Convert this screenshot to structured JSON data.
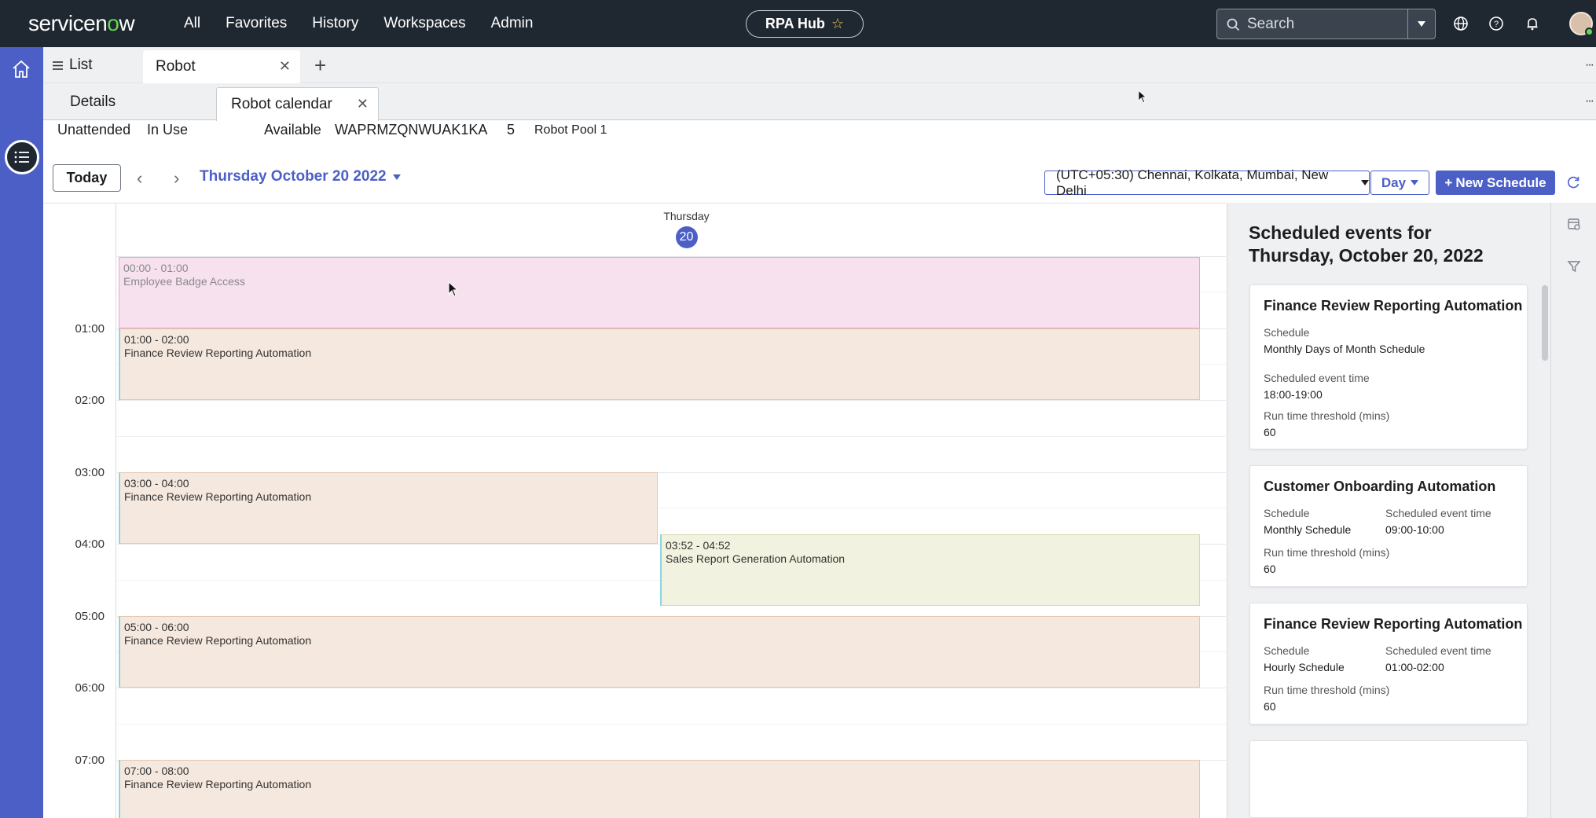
{
  "topnav": {
    "logo_left": "servicen",
    "logo_o": "o",
    "logo_right": "w",
    "menu": [
      "All",
      "Favorites",
      "History",
      "Workspaces",
      "Admin"
    ],
    "center_title": "RPA Hub",
    "search_placeholder": "Search"
  },
  "tabs1": {
    "list_label": "List",
    "robot_label": "Robot"
  },
  "tabs2": {
    "details_label": "Details",
    "calendar_label": "Robot calendar"
  },
  "info": {
    "type": "Unattended",
    "status": "In Use",
    "availability": "Available",
    "id": "WAPRMZQNWUAK1KA",
    "count": "5",
    "pool": "Robot Pool 1"
  },
  "toolbar": {
    "today_label": "Today",
    "date_label": "Thursday October 20 2022",
    "timezone": "(UTC+05:30) Chennai, Kolkata, Mumbai, New Delhi",
    "view": "Day",
    "new_schedule": "New Schedule"
  },
  "calendar": {
    "day_name": "Thursday",
    "day_number": "20",
    "hours": [
      "01:00",
      "02:00",
      "03:00",
      "04:00",
      "05:00",
      "06:00",
      "07:00"
    ],
    "events": [
      {
        "time": "00:00 - 01:00",
        "title": "Employee Badge Access",
        "color": "#f7e1ef"
      },
      {
        "time": "01:00 - 02:00",
        "title": "Finance Review Reporting Automation",
        "color": "#f5e8de"
      },
      {
        "time": "03:00 - 04:00",
        "title": "Finance Review Reporting Automation",
        "color": "#f5e8de"
      },
      {
        "time": "03:52 - 04:52",
        "title": "Sales Report Generation Automation",
        "color": "#f1f2df"
      },
      {
        "time": "05:00 - 06:00",
        "title": "Finance Review Reporting Automation",
        "color": "#f5e8de"
      },
      {
        "time": "07:00 - 08:00",
        "title": "Finance Review Reporting Automation",
        "color": "#f5e8de"
      }
    ]
  },
  "panel": {
    "heading": "Scheduled events for Thursday, October 20, 2022",
    "cards": [
      {
        "title": "Finance Review Reporting Automation",
        "schedule_label": "Schedule",
        "schedule": "Monthly Days of Month Schedule",
        "time_label": "Scheduled event time",
        "time": "18:00-19:00",
        "threshold_label": "Run time threshold (mins)",
        "threshold": "60"
      },
      {
        "title": "Customer Onboarding Automation",
        "schedule_label": "Schedule",
        "schedule": "Monthly Schedule",
        "time_label": "Scheduled event time",
        "time": "09:00-10:00",
        "threshold_label": "Run time threshold (mins)",
        "threshold": "60"
      },
      {
        "title": "Finance Review Reporting Automation",
        "schedule_label": "Schedule",
        "schedule": "Hourly Schedule",
        "time_label": "Scheduled event time",
        "time": "01:00-02:00",
        "threshold_label": "Run time threshold (mins)",
        "threshold": "60"
      }
    ]
  },
  "colors": {
    "topnav": "#1f2731",
    "accent": "#4c5fc6",
    "logo_o": "#62d84e"
  }
}
